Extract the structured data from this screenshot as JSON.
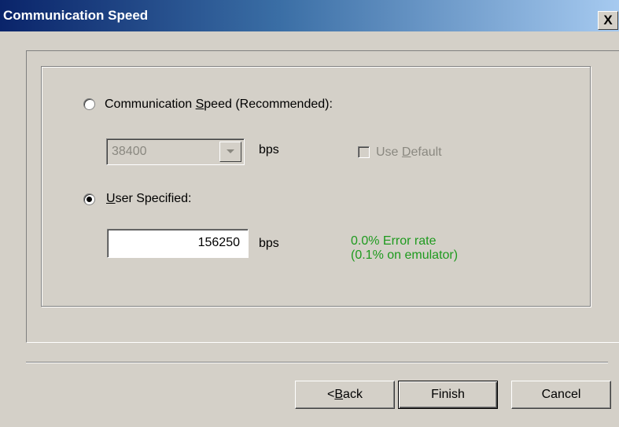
{
  "window": {
    "title": "Communication Speed",
    "close_glyph": "X"
  },
  "speed_option": {
    "label_pre": "Communication ",
    "label_mnemonic": "S",
    "label_post": "peed (Recommended):",
    "selected": false
  },
  "speed_combo": {
    "value": "38400",
    "unit": "bps",
    "enabled": false
  },
  "use_default": {
    "label_pre": "Use ",
    "label_mnemonic": "D",
    "label_post": "efault",
    "checked": false,
    "enabled": false
  },
  "user_option": {
    "label_mnemonic": "U",
    "label_post": "ser Specified:",
    "selected": true
  },
  "user_input": {
    "value": "156250",
    "unit": "bps"
  },
  "error_rate": {
    "line1": "0.0% Error rate",
    "line2": "(0.1% on emulator)",
    "color": "#1e9a1e"
  },
  "buttons": {
    "back_pre": "< ",
    "back_mnemonic": "B",
    "back_post": "ack",
    "finish": "Finish",
    "cancel": "Cancel"
  },
  "icons": {
    "close": "close-icon",
    "dropdown": "chevron-down-icon"
  }
}
